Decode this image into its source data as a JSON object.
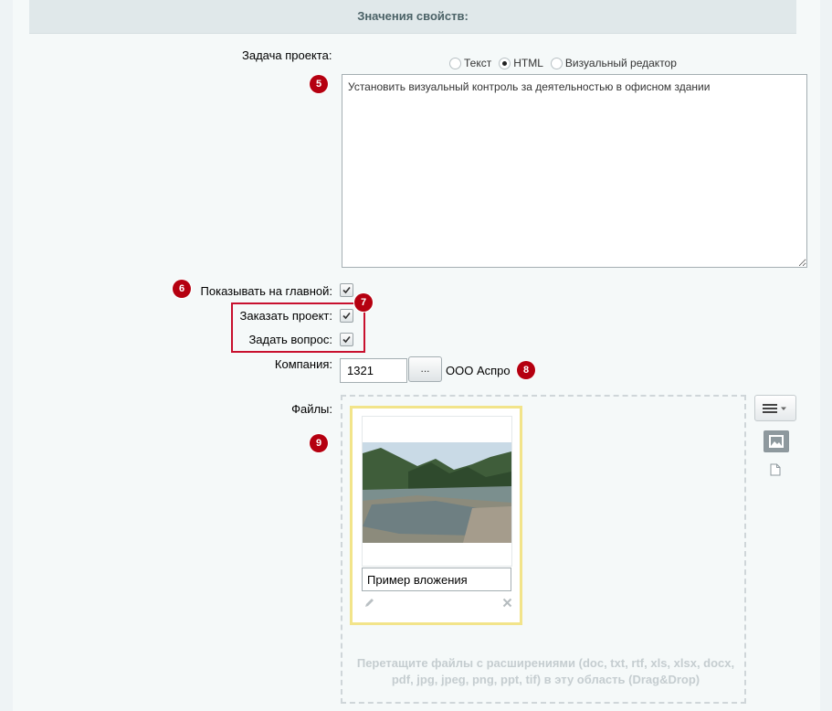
{
  "section": {
    "title": "Значения свойств:"
  },
  "task": {
    "label": "Задача проекта:",
    "badge": "5",
    "modes": [
      {
        "label": "Текст",
        "selected": false
      },
      {
        "label": "HTML",
        "selected": true
      },
      {
        "label": "Визуальный редактор",
        "selected": false
      }
    ],
    "value": "Установить визуальный контроль за деятельностью в офисном здании"
  },
  "checkboxes": {
    "show_main": {
      "label": "Показывать на главной:",
      "checked": true,
      "badge": "6"
    },
    "order_project": {
      "label": "Заказать проект:",
      "checked": true
    },
    "ask_question": {
      "label": "Задать вопрос:",
      "checked": true
    },
    "group_badge": "7"
  },
  "company": {
    "label": "Компания:",
    "value": "1321",
    "browse_label": "...",
    "name": "ООО Аспро",
    "badge": "8"
  },
  "files": {
    "label": "Файлы:",
    "badge": "9",
    "attachment": {
      "name": "Пример вложения",
      "thumb_icon": "landscape-photo"
    },
    "drop_hint": "Перетащите файлы с расширениями (doc, txt, rtf, xls, xlsx, docx, pdf, jpg, jpeg, png, ppt, tif) в эту область (Drag&Drop)",
    "menu_icon": "hamburger-menu-icon",
    "view_image_icon": "image-icon",
    "view_file_icon": "file-icon"
  },
  "colors": {
    "badge": "#b50010",
    "highlight_border": "#c8102e",
    "card_border": "#f2e48a"
  }
}
